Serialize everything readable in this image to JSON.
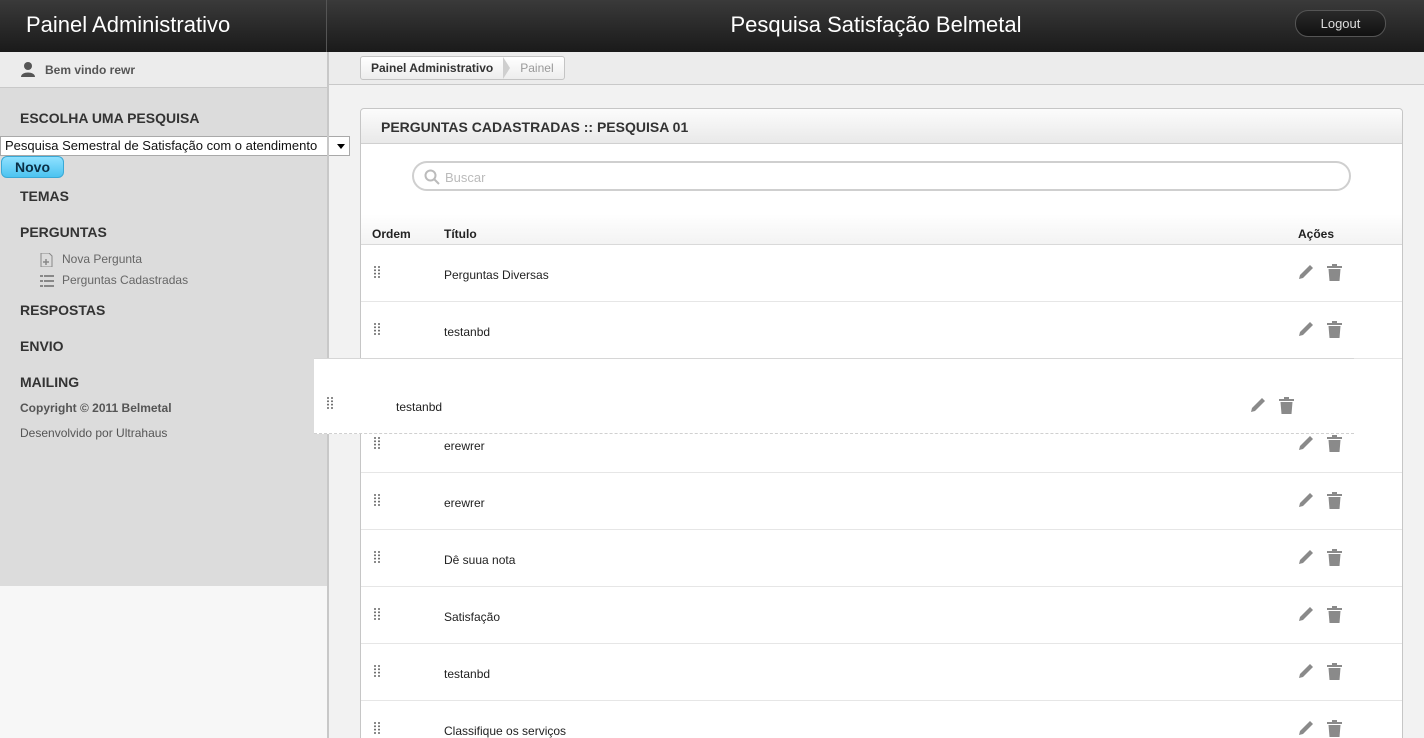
{
  "header": {
    "brand": "Painel Administrativo",
    "site_title": "Pesquisa Satisfação Belmetal",
    "logout_label": "Logout"
  },
  "sidebar": {
    "welcome": "Bem vindo rewr",
    "choose_survey_label": "ESCOLHA UMA PESQUISA",
    "selected_survey": "Pesquisa Semestral de Satisfação com o atendimento",
    "new_button": "Novo",
    "sections": {
      "temas": "TEMAS",
      "perguntas": "PERGUNTAS",
      "respostas": "RESPOSTAS",
      "envio": "ENVIO",
      "mailing": "MAILING"
    },
    "subitems": {
      "nova_pergunta": "Nova Pergunta",
      "perguntas_cadastradas": "Perguntas Cadastradas"
    },
    "copyright": "Copyright © 2011 Belmetal",
    "developer": "Desenvolvido por Ultrahaus"
  },
  "breadcrumb": {
    "items": [
      "Painel Administrativo",
      "Painel"
    ]
  },
  "panel": {
    "title": "PERGUNTAS CADASTRADAS :: PESQUISA 01",
    "search_placeholder": "Buscar",
    "columns": {
      "order": "Ordem",
      "title": "Título",
      "actions": "Ações"
    },
    "rows": [
      "Perguntas Diversas",
      "testanbd",
      "erewrer",
      "erewrer",
      "Dê suua nota",
      "Satisfação",
      "testanbd",
      "Classifique os serviços"
    ],
    "dragging_row": "testanbd"
  },
  "colors": {
    "topbar": "#1f1f1f",
    "sidebar": "#dcdcdc",
    "novo_button": "#5fcdf5",
    "icon_gray": "#8a8a8a"
  }
}
